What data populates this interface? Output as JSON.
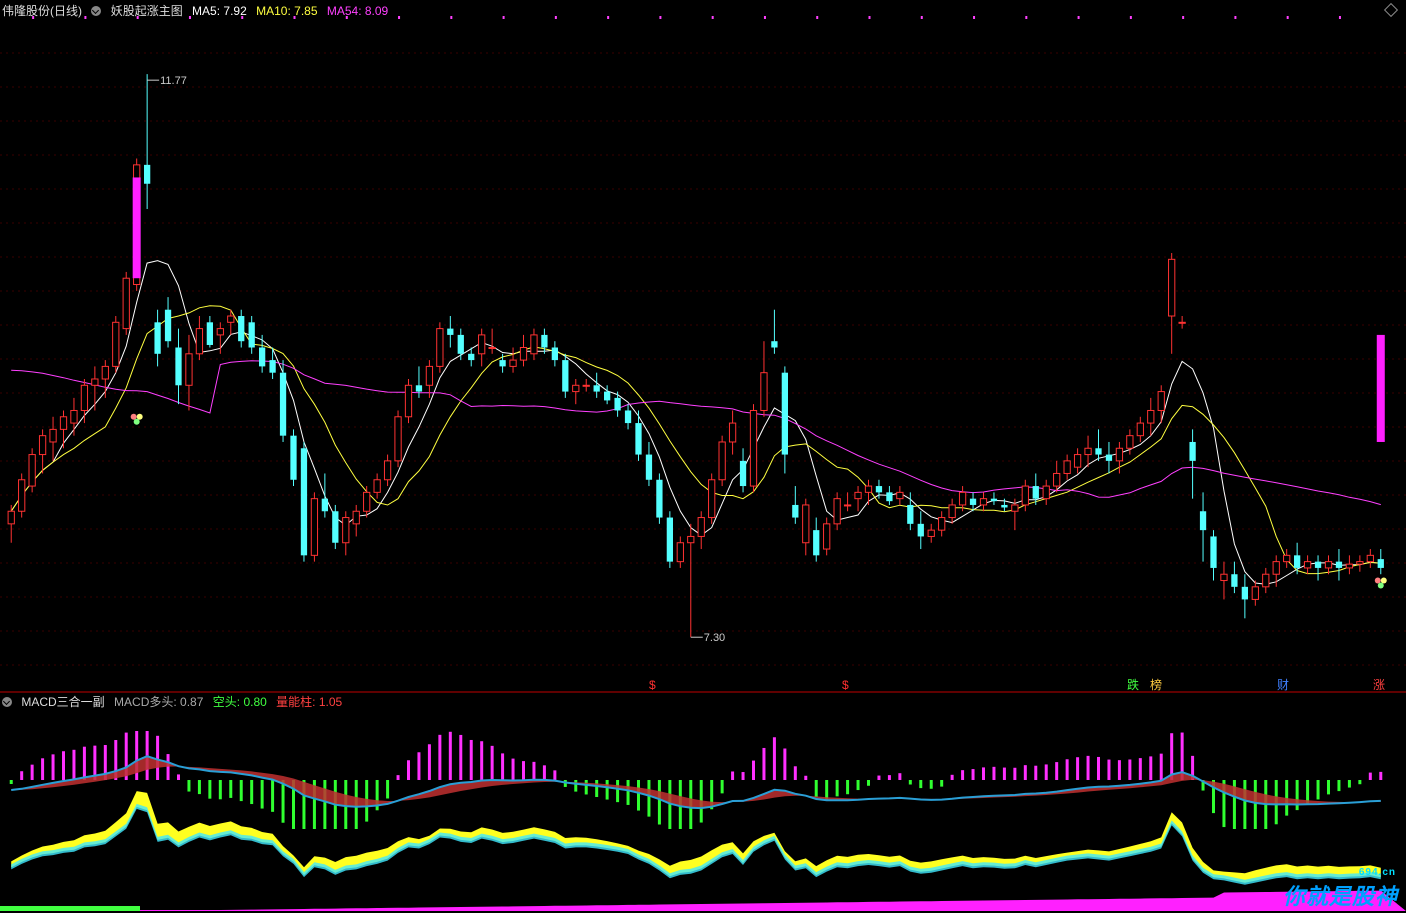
{
  "header": {
    "stock": "伟隆股份(日线)",
    "indicator": "妖股起涨主图",
    "ma5": {
      "label": "MA5:",
      "value": "7.92",
      "color": "#ffffff"
    },
    "ma10": {
      "label": "MA10:",
      "value": "7.85",
      "color": "#ffff40"
    },
    "ma54": {
      "label": "MA54:",
      "value": "8.09",
      "color": "#ff40ff"
    }
  },
  "sub_header": {
    "indicator": "MACD三合一副",
    "bull": {
      "label": "MACD多头:",
      "value": "0.87",
      "color": "#aaaaaa"
    },
    "bear": {
      "label": "空头:",
      "value": "0.80",
      "color": "#40ff40"
    },
    "volume": {
      "label": "量能柱:",
      "value": "1.05",
      "color": "#ff4040"
    }
  },
  "annotations": {
    "high": "11.77",
    "low": "7.30"
  },
  "markers": [
    {
      "text": "$",
      "color": "#ff3030"
    },
    {
      "text": "$",
      "color": "#ff3030"
    },
    {
      "text": "跌",
      "color": "#40ff40"
    },
    {
      "text": "榜",
      "color": "#ffcc40"
    },
    {
      "text": "财",
      "color": "#4080ff"
    },
    {
      "text": "涨",
      "color": "#ff4040"
    }
  ],
  "logo": {
    "text": "你就是股神",
    "site": "694.cn"
  },
  "chart_data": {
    "type": "candlestick",
    "title": "妖股起涨主图",
    "ylim": [
      7.0,
      12.2
    ],
    "candles": [
      [
        8.2,
        8.35,
        8.05,
        8.3
      ],
      [
        8.3,
        8.6,
        8.25,
        8.55
      ],
      [
        8.5,
        8.8,
        8.45,
        8.75
      ],
      [
        8.75,
        8.95,
        8.6,
        8.9
      ],
      [
        8.85,
        9.05,
        8.7,
        8.95
      ],
      [
        8.95,
        9.1,
        8.8,
        9.05
      ],
      [
        9.0,
        9.2,
        8.9,
        9.1
      ],
      [
        9.1,
        9.35,
        9.0,
        9.3
      ],
      [
        9.3,
        9.45,
        9.1,
        9.35
      ],
      [
        9.35,
        9.5,
        9.2,
        9.45
      ],
      [
        9.45,
        9.85,
        9.4,
        9.8
      ],
      [
        9.75,
        10.2,
        9.7,
        10.15
      ],
      [
        10.1,
        11.1,
        10.05,
        11.05
      ],
      [
        11.05,
        11.77,
        10.7,
        10.9
      ],
      [
        9.8,
        9.9,
        9.45,
        9.55
      ],
      [
        9.9,
        10.0,
        9.6,
        9.65
      ],
      [
        9.6,
        9.75,
        9.15,
        9.3
      ],
      [
        9.3,
        9.7,
        9.1,
        9.55
      ],
      [
        9.55,
        9.85,
        9.5,
        9.75
      ],
      [
        9.8,
        9.85,
        9.6,
        9.62
      ],
      [
        9.7,
        9.8,
        9.55,
        9.75
      ],
      [
        9.8,
        9.9,
        9.7,
        9.85
      ],
      [
        9.85,
        9.9,
        9.6,
        9.65
      ],
      [
        9.8,
        9.85,
        9.55,
        9.6
      ],
      [
        9.6,
        9.7,
        9.4,
        9.45
      ],
      [
        9.5,
        9.6,
        9.35,
        9.4
      ],
      [
        9.4,
        9.5,
        8.85,
        8.9
      ],
      [
        8.9,
        8.95,
        8.5,
        8.55
      ],
      [
        8.8,
        8.85,
        7.9,
        7.95
      ],
      [
        7.95,
        8.45,
        7.9,
        8.4
      ],
      [
        8.4,
        8.6,
        8.25,
        8.3
      ],
      [
        8.3,
        8.35,
        8.0,
        8.05
      ],
      [
        8.05,
        8.3,
        7.95,
        8.25
      ],
      [
        8.2,
        8.35,
        8.1,
        8.3
      ],
      [
        8.3,
        8.5,
        8.25,
        8.45
      ],
      [
        8.45,
        8.6,
        8.4,
        8.55
      ],
      [
        8.55,
        8.75,
        8.5,
        8.7
      ],
      [
        8.7,
        9.1,
        8.65,
        9.05
      ],
      [
        9.05,
        9.35,
        9.0,
        9.3
      ],
      [
        9.3,
        9.45,
        9.2,
        9.25
      ],
      [
        9.3,
        9.5,
        9.2,
        9.45
      ],
      [
        9.45,
        9.8,
        9.4,
        9.75
      ],
      [
        9.75,
        9.85,
        9.6,
        9.7
      ],
      [
        9.7,
        9.75,
        9.5,
        9.55
      ],
      [
        9.55,
        9.6,
        9.45,
        9.5
      ],
      [
        9.55,
        9.75,
        9.45,
        9.7
      ],
      [
        9.6,
        9.75,
        9.55,
        9.6
      ],
      [
        9.5,
        9.55,
        9.4,
        9.45
      ],
      [
        9.45,
        9.6,
        9.4,
        9.5
      ],
      [
        9.5,
        9.7,
        9.45,
        9.6
      ],
      [
        9.55,
        9.75,
        9.5,
        9.7
      ],
      [
        9.7,
        9.75,
        9.55,
        9.6
      ],
      [
        9.6,
        9.65,
        9.45,
        9.5
      ],
      [
        9.5,
        9.55,
        9.2,
        9.25
      ],
      [
        9.25,
        9.35,
        9.15,
        9.3
      ],
      [
        9.3,
        9.35,
        9.25,
        9.3
      ],
      [
        9.3,
        9.4,
        9.2,
        9.25
      ],
      [
        9.25,
        9.3,
        9.15,
        9.18
      ],
      [
        9.2,
        9.25,
        9.05,
        9.1
      ],
      [
        9.1,
        9.15,
        8.95,
        9.0
      ],
      [
        9.0,
        9.1,
        8.7,
        8.75
      ],
      [
        8.75,
        8.85,
        8.5,
        8.55
      ],
      [
        8.55,
        8.6,
        8.2,
        8.25
      ],
      [
        8.25,
        8.3,
        7.85,
        7.9
      ],
      [
        7.9,
        8.1,
        7.85,
        8.05
      ],
      [
        8.05,
        8.2,
        7.3,
        8.1
      ],
      [
        8.1,
        8.3,
        8.0,
        8.25
      ],
      [
        8.25,
        8.6,
        8.2,
        8.55
      ],
      [
        8.55,
        8.9,
        8.5,
        8.85
      ],
      [
        8.85,
        9.1,
        8.75,
        9.0
      ],
      [
        8.7,
        8.8,
        8.45,
        8.5
      ],
      [
        8.5,
        9.15,
        8.45,
        9.1
      ],
      [
        9.1,
        9.65,
        9.05,
        9.4
      ],
      [
        9.65,
        9.9,
        9.55,
        9.6
      ],
      [
        9.4,
        9.45,
        8.6,
        8.75
      ],
      [
        8.35,
        8.5,
        8.2,
        8.25
      ],
      [
        8.05,
        8.4,
        7.95,
        8.35
      ],
      [
        8.15,
        8.25,
        7.9,
        7.95
      ],
      [
        8.0,
        8.25,
        7.95,
        8.2
      ],
      [
        8.2,
        8.45,
        8.15,
        8.4
      ],
      [
        8.35,
        8.45,
        8.3,
        8.35
      ],
      [
        8.4,
        8.5,
        8.3,
        8.45
      ],
      [
        8.45,
        8.55,
        8.35,
        8.5
      ],
      [
        8.5,
        8.55,
        8.4,
        8.45
      ],
      [
        8.45,
        8.5,
        8.35,
        8.38
      ],
      [
        8.4,
        8.5,
        8.35,
        8.45
      ],
      [
        8.35,
        8.45,
        8.15,
        8.2
      ],
      [
        8.2,
        8.3,
        8.0,
        8.1
      ],
      [
        8.1,
        8.2,
        8.05,
        8.15
      ],
      [
        8.15,
        8.3,
        8.1,
        8.25
      ],
      [
        8.25,
        8.4,
        8.2,
        8.35
      ],
      [
        8.35,
        8.5,
        8.3,
        8.45
      ],
      [
        8.4,
        8.45,
        8.3,
        8.35
      ],
      [
        8.35,
        8.45,
        8.3,
        8.4
      ],
      [
        8.4,
        8.45,
        8.35,
        8.38
      ],
      [
        8.35,
        8.4,
        8.3,
        8.33
      ],
      [
        8.3,
        8.4,
        8.15,
        8.35
      ],
      [
        8.35,
        8.55,
        8.3,
        8.5
      ],
      [
        8.5,
        8.6,
        8.35,
        8.4
      ],
      [
        8.4,
        8.55,
        8.35,
        8.5
      ],
      [
        8.5,
        8.7,
        8.45,
        8.6
      ],
      [
        8.6,
        8.75,
        8.55,
        8.7
      ],
      [
        8.65,
        8.8,
        8.6,
        8.75
      ],
      [
        8.75,
        8.9,
        8.65,
        8.8
      ],
      [
        8.8,
        8.95,
        8.7,
        8.75
      ],
      [
        8.75,
        8.85,
        8.6,
        8.7
      ],
      [
        8.7,
        8.85,
        8.6,
        8.8
      ],
      [
        8.8,
        8.95,
        8.75,
        8.9
      ],
      [
        8.9,
        9.05,
        8.85,
        9.0
      ],
      [
        9.0,
        9.2,
        8.9,
        9.1
      ],
      [
        9.1,
        9.3,
        9.0,
        9.25
      ],
      [
        9.85,
        10.35,
        9.55,
        10.3
      ],
      [
        9.8,
        9.85,
        9.75,
        9.8
      ],
      [
        8.85,
        8.95,
        8.4,
        8.7
      ],
      [
        8.3,
        8.45,
        7.9,
        8.15
      ],
      [
        8.1,
        8.15,
        7.75,
        7.85
      ],
      [
        7.75,
        7.9,
        7.6,
        7.8
      ],
      [
        7.8,
        7.9,
        7.65,
        7.7
      ],
      [
        7.7,
        7.8,
        7.45,
        7.6
      ],
      [
        7.6,
        7.75,
        7.55,
        7.7
      ],
      [
        7.7,
        7.85,
        7.65,
        7.8
      ],
      [
        7.8,
        7.95,
        7.7,
        7.9
      ],
      [
        7.9,
        8.0,
        7.85,
        7.95
      ],
      [
        7.95,
        8.05,
        7.8,
        7.85
      ],
      [
        7.85,
        7.95,
        7.8,
        7.9
      ],
      [
        7.9,
        7.95,
        7.75,
        7.85
      ],
      [
        7.85,
        7.95,
        7.8,
        7.9
      ],
      [
        7.9,
        8.0,
        7.75,
        7.85
      ],
      [
        7.85,
        7.95,
        7.8,
        7.88
      ],
      [
        7.88,
        7.95,
        7.82,
        7.9
      ],
      [
        7.9,
        8.0,
        7.85,
        7.95
      ],
      [
        7.92,
        8.0,
        7.8,
        7.85
      ]
    ]
  }
}
